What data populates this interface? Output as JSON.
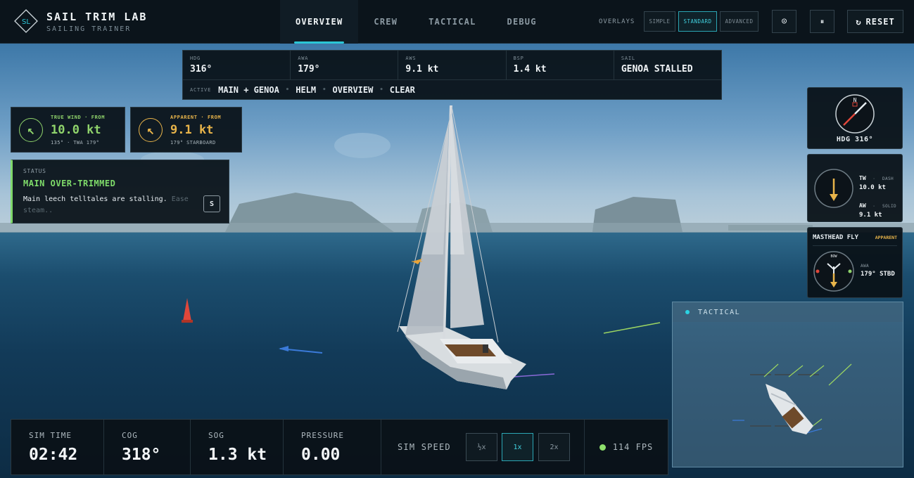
{
  "brand": {
    "title": "SAIL TRIM LAB",
    "subtitle": "SAILING TRAINER",
    "logo_text": "SL"
  },
  "nav": {
    "tabs": [
      {
        "label": "OVERVIEW"
      },
      {
        "label": "CREW"
      },
      {
        "label": "TACTICAL"
      },
      {
        "label": "DEBUG"
      }
    ],
    "active": "OVERVIEW"
  },
  "overlays": {
    "label": "OVERLAYS",
    "options": [
      "SIMPLE",
      "STANDARD",
      "ADVANCED"
    ],
    "selected": "STANDARD"
  },
  "controls": {
    "target_icon": "⊙",
    "pause_icon": "⏸",
    "reset_icon": "↻",
    "reset_label": "RESET"
  },
  "telemetry": {
    "hdg": {
      "label": "HDG",
      "value": "316°"
    },
    "awa": {
      "label": "AWA",
      "value": "179°"
    },
    "aws": {
      "label": "AWS",
      "value": "9.1 kt"
    },
    "bsp": {
      "label": "BSP",
      "value": "1.4 kt"
    },
    "sail": {
      "label": "SAIL",
      "value": "GENOA STALLED"
    },
    "active_label": "ACTIVE",
    "active_items": [
      "MAIN + GENOA",
      "HELM",
      "OVERVIEW",
      "CLEAR"
    ]
  },
  "true_wind": {
    "label": "TRUE WIND · FROM",
    "value": "10.0 kt",
    "sub": "135° · TWA 179°",
    "color": "#8fd36b"
  },
  "apparent_wind": {
    "label": "APPARENT · FROM",
    "value": "9.1 kt",
    "sub": "179° STARBOARD",
    "color": "#e8b44a"
  },
  "status": {
    "label": "STATUS",
    "title": "MAIN OVER-TRIMMED",
    "message": "Main leech telltales are stalling.",
    "hint": "Ease steam..",
    "key": "S"
  },
  "compass": {
    "north": "N",
    "caption": "HDG 316°"
  },
  "wind_gauge": {
    "tw_label": "TW",
    "tw_style": "DASH",
    "tw_value": "10.0 kt",
    "aw_label": "AW",
    "aw_style": "SOLID",
    "aw_value": "9.1 kt"
  },
  "masthead": {
    "title": "MASTHEAD FLY",
    "tag": "APPARENT",
    "bow_label": "BOW",
    "awa_label": "AWA",
    "awa_value": "179° STBD"
  },
  "tactical": {
    "title": "TACTICAL"
  },
  "bottom": {
    "sim_time": {
      "label": "SIM TIME",
      "value": "02:42"
    },
    "cog": {
      "label": "COG",
      "value": "318°"
    },
    "sog": {
      "label": "SOG",
      "value": "1.3 kt"
    },
    "pressure": {
      "label": "PRESSURE",
      "value": "0.00"
    },
    "sim_speed_label": "SIM SPEED",
    "speeds": [
      "½x",
      "1x",
      "2x"
    ],
    "speed_selected": "1x",
    "fps": "114 FPS"
  },
  "colors": {
    "accent": "#2bc6d6",
    "true_wind": "#8fd36b",
    "apparent": "#e8b44a",
    "stall_red": "#e0473a"
  }
}
